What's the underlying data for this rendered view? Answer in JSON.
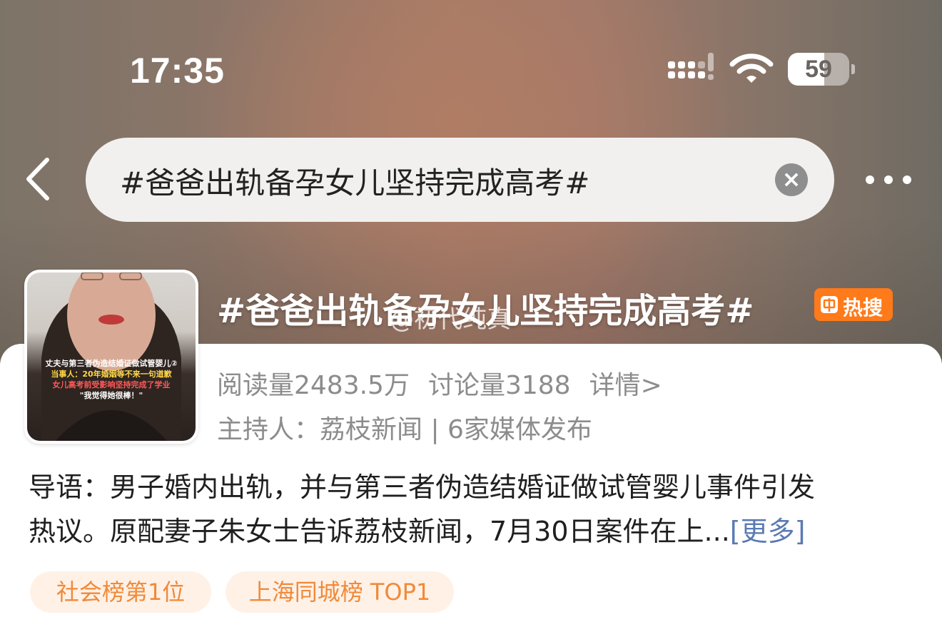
{
  "status_bar": {
    "time": "17:35",
    "battery_level": "59",
    "battery_fraction": 0.59,
    "icons": [
      "signal-icon",
      "wifi-icon",
      "battery-icon"
    ]
  },
  "nav": {
    "back_icon": "chevron-left-icon",
    "search_query": "#爸爸出轨备孕女儿坚持完成高考#",
    "clear_icon": "close-circle-icon",
    "clear_glyph": "×",
    "more_icon": "more-dots-icon"
  },
  "topic": {
    "title": "#爸爸出轨备孕女儿坚持完成高考#",
    "hot_badge": "热搜",
    "watermark": "@初代纯真",
    "cover": {
      "caption_lines": [
        "丈夫与第三者伪造结婚证做试管婴儿②",
        "当事人：20年婚姻等不来一句道歉",
        "女儿高考前受影响坚持完成了学业",
        "\"我觉得她很棒！\""
      ]
    },
    "stats": {
      "reads": "阅读量2483.5万",
      "discussions": "讨论量3188",
      "details_link": "详情>"
    },
    "host_line": "主持人：荔枝新闻 | 6家媒体发布"
  },
  "intro": {
    "line1": "导语：男子婚内出轨，并与第三者伪造结婚证做试管婴儿事件引发",
    "line2": "热议。原配妻子朱女士告诉荔枝新闻，7月30日案件在上...",
    "more_link": "[更多]"
  },
  "tags": [
    "社会榜第1位",
    "上海同城榜 TOP1"
  ],
  "colors": {
    "accent_orange": "#ff7a1a",
    "tag_text": "#f08a3a",
    "tag_bg": "#fff1e6",
    "link_blue": "#5b7ab3",
    "muted_text": "#8c8c8c"
  }
}
